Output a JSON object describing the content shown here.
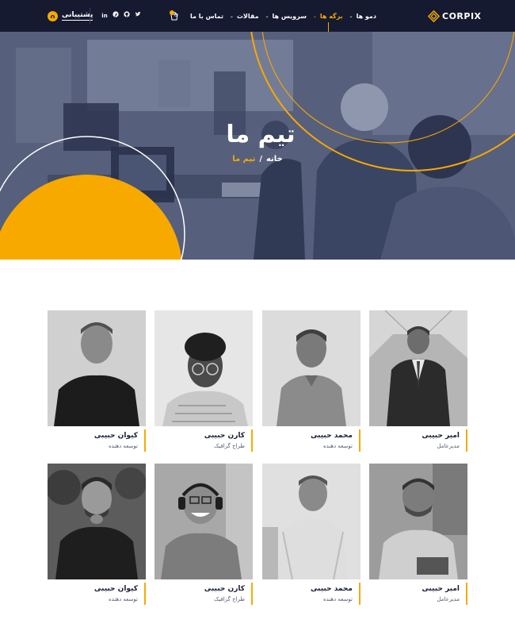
{
  "navbar": {
    "support_label": "پشتیبانی",
    "socials": [
      "in",
      "P",
      "G",
      "T"
    ],
    "cart_count": "0",
    "menu": [
      {
        "label": "دمو ها",
        "active": false
      },
      {
        "label": "برگه ها",
        "active": true
      },
      {
        "label": "سرویس ها",
        "active": false
      },
      {
        "label": "مقالات",
        "active": false
      },
      {
        "label": "تماس با ما",
        "active": false
      }
    ],
    "logo_text": "CORPIX"
  },
  "hero": {
    "title": "تیم ما",
    "breadcrumb_home": "خانه",
    "breadcrumb_sep": "/",
    "breadcrumb_current": "تیم ما"
  },
  "team": [
    {
      "name": "امیر حبیبی",
      "role": "مدیرعامل"
    },
    {
      "name": "محمد حبیبی",
      "role": "توسعه دهنده"
    },
    {
      "name": "کارن حبیبی",
      "role": "طراح گرافیک"
    },
    {
      "name": "کیوان حبیبی",
      "role": "توسعه دهنده"
    },
    {
      "name": "امیر حبیبی",
      "role": "مدیرعامل"
    },
    {
      "name": "محمد حبیبی",
      "role": "توسعه دهنده"
    },
    {
      "name": "کارن حبیبی",
      "role": "طراح گرافیک"
    },
    {
      "name": "کیوان حبیبی",
      "role": "توسعه دهنده"
    }
  ],
  "colors": {
    "navy": "#151a30",
    "accent": "#f8a900",
    "hero_overlay": "#47516f"
  }
}
